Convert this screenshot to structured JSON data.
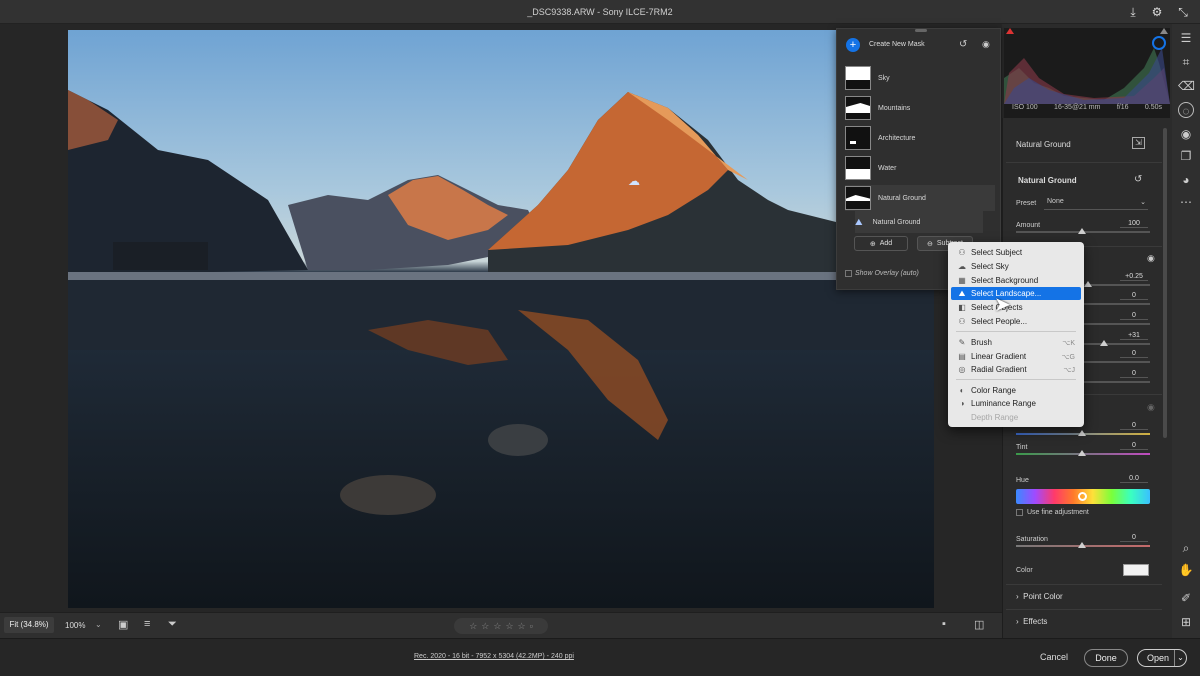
{
  "window": {
    "title": "_DSC9338.ARW  -  Sony ILCE-7RM2"
  },
  "masks": {
    "create_label": "Create New Mask",
    "items": [
      {
        "label": "Sky"
      },
      {
        "label": "Mountains"
      },
      {
        "label": "Architecture"
      },
      {
        "label": "Water"
      },
      {
        "label": "Natural Ground"
      },
      {
        "label": "Natural Ground"
      }
    ],
    "add_label": "Add",
    "subtract_label": "Subtract",
    "overlay_label": "Show Overlay (auto)"
  },
  "menu": {
    "items": [
      {
        "label": "Select Subject",
        "shortcut": ""
      },
      {
        "label": "Select Sky",
        "shortcut": ""
      },
      {
        "label": "Select Background",
        "shortcut": ""
      },
      {
        "label": "Select Landscape...",
        "shortcut": ""
      },
      {
        "label": "Select Objects",
        "shortcut": ""
      },
      {
        "label": "Select People...",
        "shortcut": ""
      },
      {
        "label": "Brush",
        "shortcut": "⌥K"
      },
      {
        "label": "Linear Gradient",
        "shortcut": "⌥G"
      },
      {
        "label": "Radial Gradient",
        "shortcut": "⌥J"
      },
      {
        "label": "Color Range",
        "shortcut": ""
      },
      {
        "label": "Luminance Range",
        "shortcut": ""
      },
      {
        "label": "Depth Range",
        "shortcut": ""
      }
    ]
  },
  "histogram": {
    "iso": "ISO 100",
    "lens": "16-35@21 mm",
    "aperture": "f/16",
    "shutter": "0.50s"
  },
  "adjust": {
    "header": "Natural Ground",
    "panel_title": "Natural Ground",
    "preset_label": "Preset",
    "preset_value": "None",
    "amount_label": "Amount",
    "amount_value": "100",
    "values": [
      "+0.25",
      "0",
      "0",
      "+31",
      "0",
      "0"
    ],
    "tint_label": "Tint",
    "temp_value": "0",
    "tint_value": "0",
    "hue_label": "Hue",
    "hue_value": "0.0",
    "fine_label": "Use fine adjustment",
    "saturation_label": "Saturation",
    "saturation_value": "0",
    "color_label": "Color",
    "point_color_label": "Point Color",
    "effects_label": "Effects"
  },
  "bottom": {
    "fit": "Fit (34.8%)",
    "zoom": "100%"
  },
  "status": {
    "info": "Rec. 2020 - 16 bit - 7952 x 5304 (42.2MP) - 240 ppi",
    "cancel": "Cancel",
    "done": "Done",
    "open": "Open"
  },
  "colors": {
    "accent": "#1473e6",
    "panel": "#2b2b2b"
  }
}
